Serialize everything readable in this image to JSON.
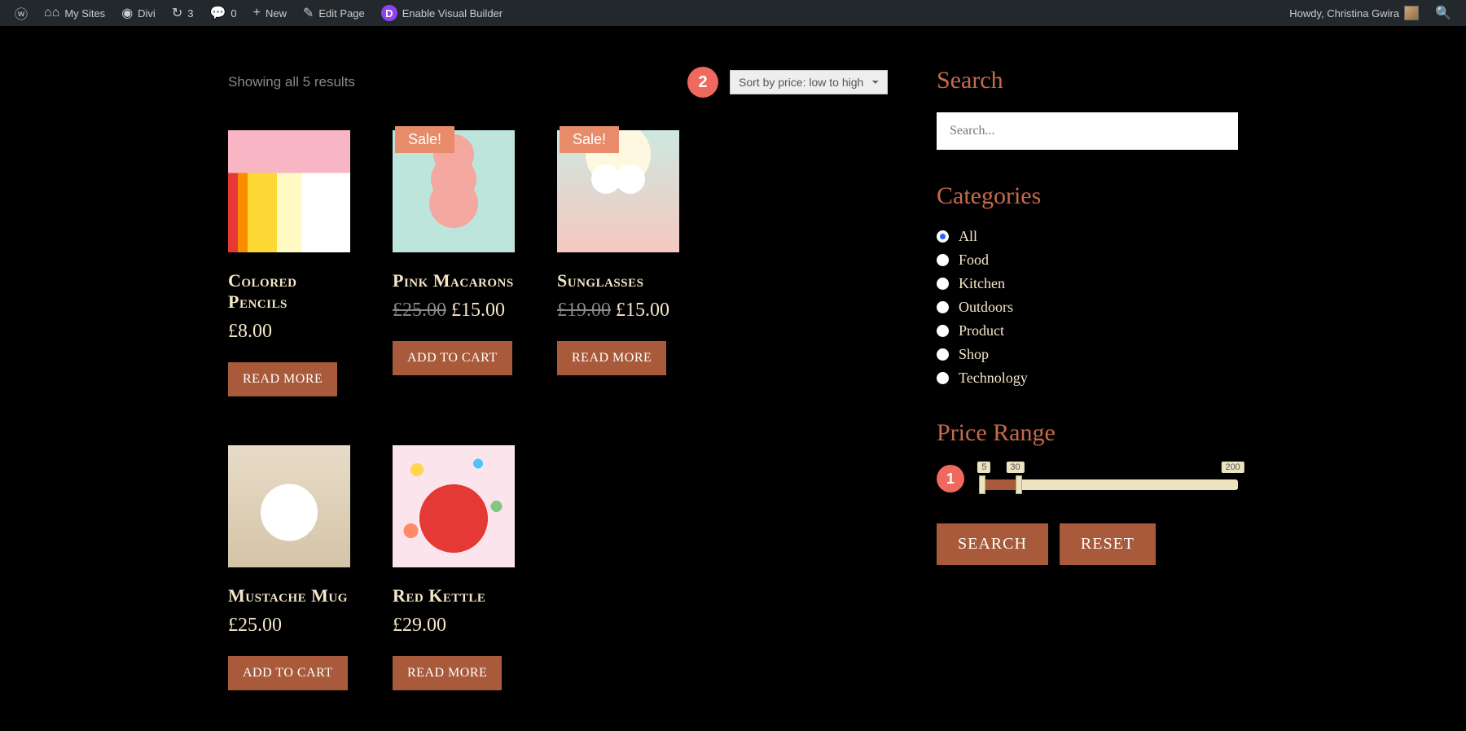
{
  "adminbar": {
    "mysites": "My Sites",
    "divi": "Divi",
    "updates_count": "3",
    "comments_count": "0",
    "new": "New",
    "edit_page": "Edit Page",
    "visual_builder": "Enable Visual Builder",
    "howdy": "Howdy, Christina Gwira"
  },
  "shop": {
    "results_text": "Showing all 5 results",
    "sort_selected": "Sort by price: low to high",
    "badge2": "2",
    "products": [
      {
        "title": "Colored Pencils",
        "price": "£8.00",
        "old_price": "",
        "sale": false,
        "button": "READ MORE"
      },
      {
        "title": "Pink Macarons",
        "price": "£15.00",
        "old_price": "£25.00",
        "sale": true,
        "button": "ADD TO CART"
      },
      {
        "title": "Sunglasses",
        "price": "£15.00",
        "old_price": "£19.00",
        "sale": true,
        "button": "READ MORE"
      },
      {
        "title": "Mustache Mug",
        "price": "£25.00",
        "old_price": "",
        "sale": false,
        "button": "ADD TO CART"
      },
      {
        "title": "Red Kettle",
        "price": "£29.00",
        "old_price": "",
        "sale": false,
        "button": "READ MORE"
      }
    ],
    "sale_label": "Sale!"
  },
  "sidebar": {
    "search_title": "Search",
    "search_placeholder": "Search...",
    "categories_title": "Categories",
    "categories": [
      "All",
      "Food",
      "Kitchen",
      "Outdoors",
      "Product",
      "Shop",
      "Technology"
    ],
    "selected_category": "All",
    "price_title": "Price Range",
    "badge1": "1",
    "range": {
      "min": 5,
      "low": 5,
      "high": 30,
      "max": 200,
      "low_label": "5",
      "high_label": "30",
      "max_label": "200"
    },
    "search_btn": "SEARCH",
    "reset_btn": "RESET"
  }
}
